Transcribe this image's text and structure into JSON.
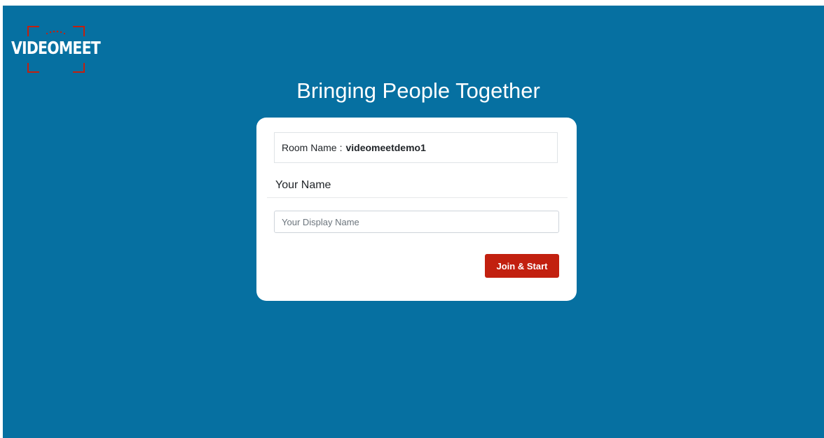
{
  "brand": {
    "logo_text": "VIDEOMEET",
    "accent_color": "#c2200f"
  },
  "page": {
    "background_color": "#0670a1",
    "headline": "Bringing People Together"
  },
  "join_form": {
    "room_label": "Room Name",
    "room_separator": ":",
    "room_value": "videomeetdemo1",
    "section_title": "Your Name",
    "name_input": {
      "value": "",
      "placeholder": "Your Display Name"
    },
    "submit_label": "Join & Start"
  }
}
